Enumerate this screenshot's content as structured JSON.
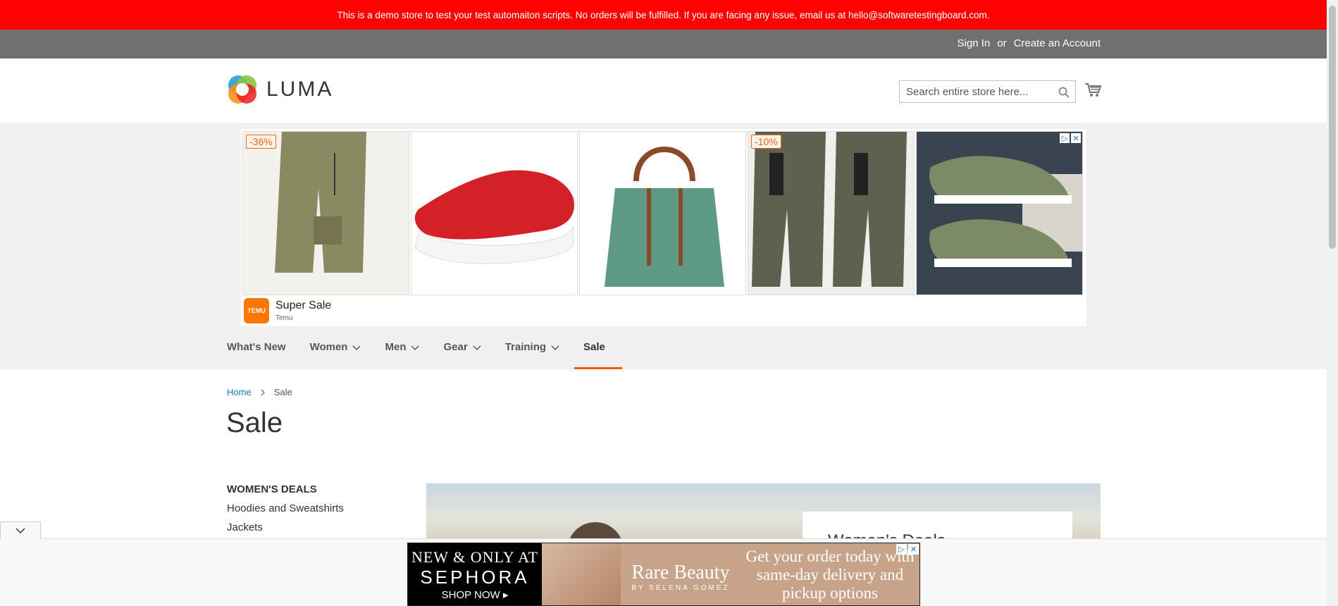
{
  "promo": {
    "text": "This is a demo store to test your test automaiton scripts. No orders will be fulfilled. If you are facing any issue, email us at hello@softwaretestingboard.com."
  },
  "topbar": {
    "sign_in": "Sign In",
    "or": "or",
    "create_account": "Create an Account"
  },
  "header": {
    "logo_text": "LUMA",
    "search_placeholder": "Search entire store here...",
    "icons": {
      "search": "search-icon",
      "cart": "cart-icon"
    }
  },
  "ad": {
    "tiles": [
      {
        "name": "cargo-shorts",
        "discount": "-36%"
      },
      {
        "name": "red-slip-on-shoe",
        "discount": ""
      },
      {
        "name": "green-handbag",
        "discount": ""
      },
      {
        "name": "gray-cargo-shorts",
        "discount": "-10%"
      },
      {
        "name": "green-sneakers",
        "discount": ""
      }
    ],
    "title": "Super Sale",
    "advertiser": "Temu",
    "logo_text": "TEMU"
  },
  "nav": {
    "items": [
      {
        "label": "What's New",
        "dropdown": false
      },
      {
        "label": "Women",
        "dropdown": true
      },
      {
        "label": "Men",
        "dropdown": true
      },
      {
        "label": "Gear",
        "dropdown": true
      },
      {
        "label": "Training",
        "dropdown": true
      },
      {
        "label": "Sale",
        "dropdown": false,
        "active": true
      }
    ]
  },
  "breadcrumb": {
    "home": "Home",
    "current": "Sale"
  },
  "page": {
    "title": "Sale"
  },
  "sidebar": {
    "heading": "WOMEN'S DEALS",
    "items": [
      "Hoodies and Sweatshirts",
      "Jackets"
    ]
  },
  "hero": {
    "card_title": "Women's Deals"
  },
  "bottom_ad": {
    "line1": "NEW & ONLY AT",
    "line2": "SEPHORA",
    "line3": "SHOP NOW ▸",
    "brand": "Rare Beauty",
    "brand_sub": "BY SELENA GOMEZ",
    "copy": "Get your order today with same-day delivery and pickup options"
  },
  "colors": {
    "promo_bg": "#ff0101",
    "topbar_bg": "#6e716e",
    "accent": "#ff5501",
    "link": "#1979c3"
  }
}
